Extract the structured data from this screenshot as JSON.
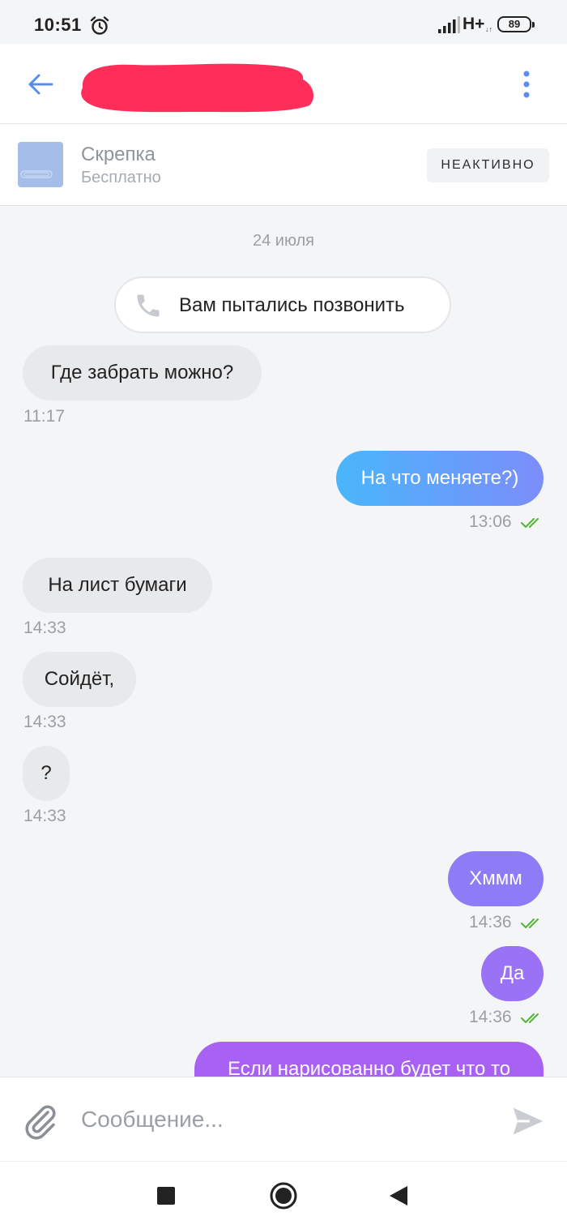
{
  "status_bar": {
    "time": "10:51",
    "network": "H+",
    "network_sub": "↓↑",
    "battery": "89"
  },
  "header": {
    "contact_name_redacted": "",
    "accent": "#5b8def"
  },
  "listing": {
    "title": "Скрепка",
    "price": "Бесплатно",
    "status": "НЕАКТИВНО"
  },
  "chat": {
    "date": "24 июля",
    "call_notice": "Вам пытались позвонить",
    "messages": [
      {
        "direction": "in",
        "text": "Где забрать можно?",
        "time": "11:17"
      },
      {
        "direction": "out",
        "text": "На что меняете?)",
        "time": "13:06"
      },
      {
        "direction": "in",
        "text": "На лист бумаги",
        "time": "14:33"
      },
      {
        "direction": "in",
        "text": "Сойдёт,",
        "time": "14:33"
      },
      {
        "direction": "in",
        "text": "?",
        "time": "14:33"
      },
      {
        "direction": "out",
        "text": "Хммм",
        "time": "14:36"
      },
      {
        "direction": "out",
        "text": "Да",
        "time": "14:36"
      },
      {
        "direction": "out",
        "text": "Если нарисованно будет что то",
        "time": ""
      }
    ]
  },
  "composer": {
    "placeholder": "Сообщение..."
  },
  "colors": {
    "out_blue_start": "#49b6fb",
    "out_blue_end": "#7c8dfb",
    "out_purple": "#8e7cf7",
    "out_violet": "#a861f2",
    "read_check": "#54b435"
  }
}
